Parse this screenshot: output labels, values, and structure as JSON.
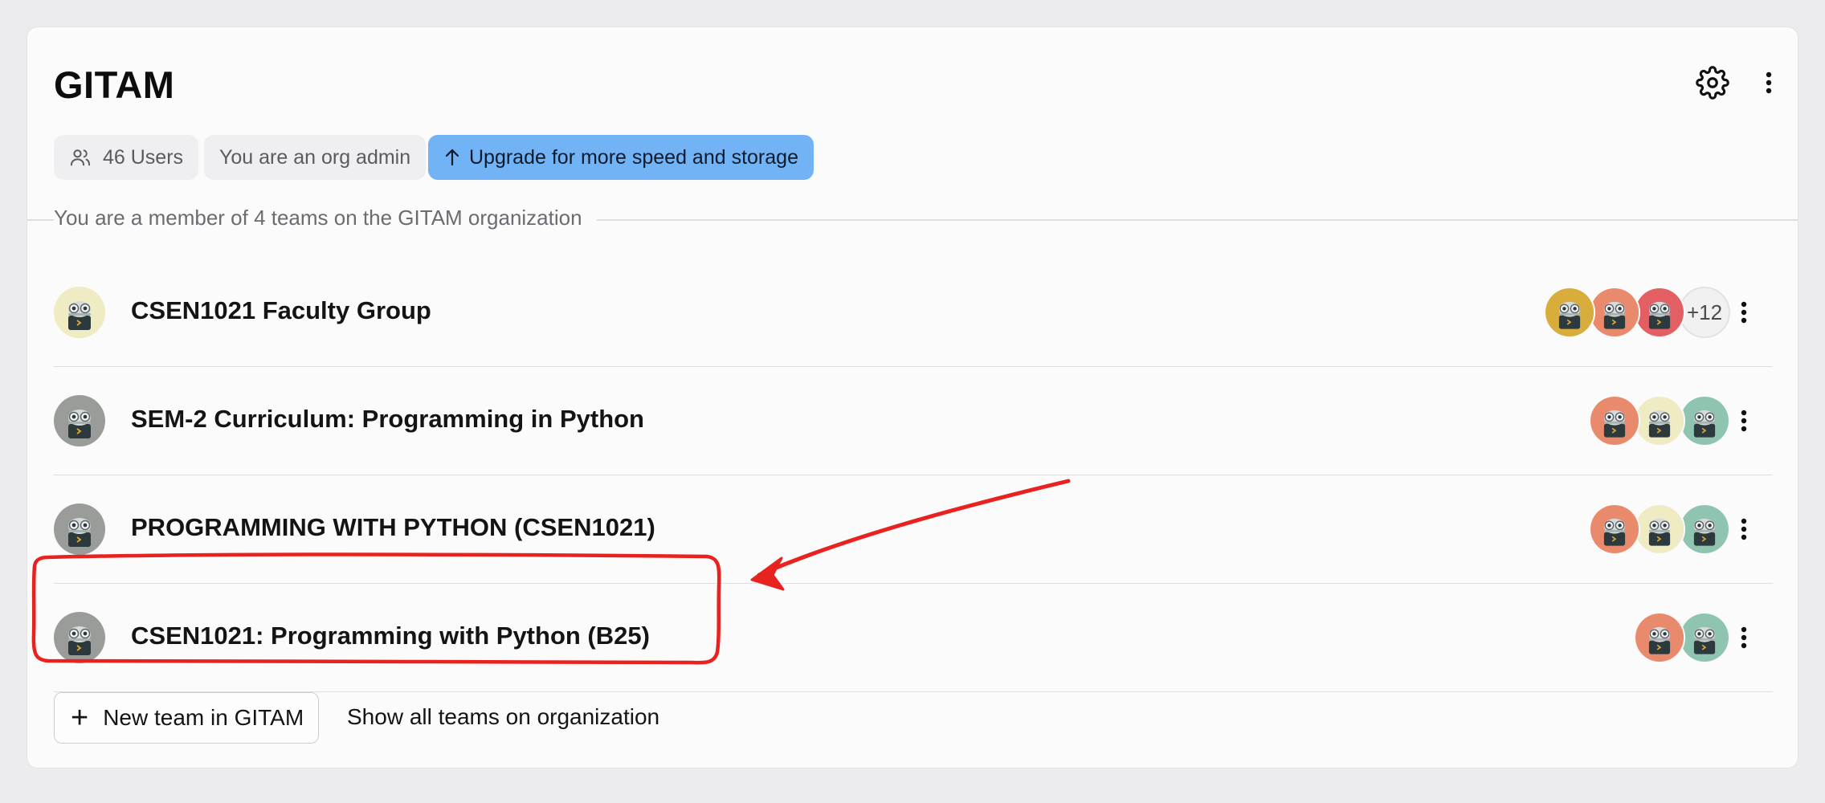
{
  "org": {
    "title": "GITAM"
  },
  "header": {
    "settings_icon": "gear-icon",
    "menu_icon": "vertical-dots-icon"
  },
  "badges": {
    "users": "46 Users",
    "role": "You are an org admin",
    "upgrade": "Upgrade for more speed and storage"
  },
  "section": {
    "label": "You are a member of 4 teams on the GITAM organization"
  },
  "teams": [
    {
      "name": "CSEN1021 Faculty Group",
      "avatar_color": "#efebc2",
      "members": [
        "#d8ad3b",
        "#ea8a6c",
        "#e45f63"
      ],
      "more": "+12"
    },
    {
      "name": "SEM-2 Curriculum: Programming in Python",
      "avatar_color": "#9a9c9a",
      "members": [
        "#ea8a6c",
        "#efebc2",
        "#8fc4b0"
      ],
      "more": ""
    },
    {
      "name": "PROGRAMMING WITH PYTHON (CSEN1021)",
      "avatar_color": "#9a9c9a",
      "members": [
        "#ea8a6c",
        "#efebc2",
        "#8fc4b0"
      ],
      "more": ""
    },
    {
      "name": "CSEN1021: Programming with Python (B25)",
      "avatar_color": "#9a9c9a",
      "members": [
        "#ea8a6c",
        "#8fc4b0"
      ],
      "more": ""
    }
  ],
  "footer": {
    "new_team": "New team in GITAM",
    "show_all": "Show all teams on organization"
  },
  "colors": {
    "upgrade_bg": "#72b3f5",
    "annotation": "#e8231f"
  }
}
